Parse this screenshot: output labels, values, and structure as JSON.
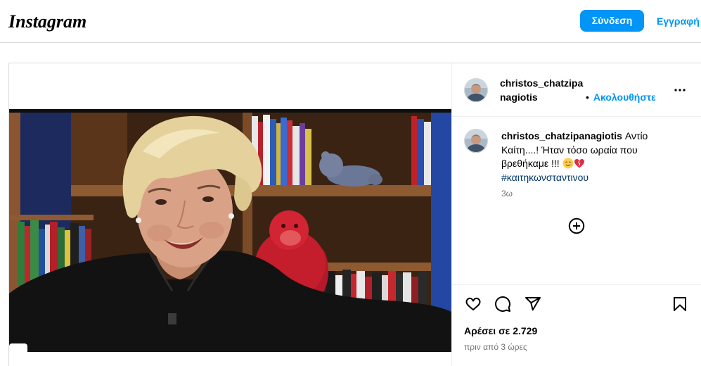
{
  "header": {
    "logo_text": "Instagram",
    "login_label": "Σύνδεση",
    "signup_label": "Εγγραφή"
  },
  "post": {
    "author": {
      "username": "christos_chatzipanagiotis",
      "follow_separator": "•",
      "follow_label": "Ακολουθήστε",
      "more_icon": "more-options-icon"
    },
    "caption": {
      "username": "christos_chatzipanagiotis",
      "text": "Αντίο Καίτη....! Ήταν τόσο ωραία που βρεθήκαμε !!!",
      "emoji_icons": [
        "smiling-face-with-tear",
        "broken-heart"
      ],
      "hashtag": "#καιτηκωνσταντινου",
      "time": "3ω"
    },
    "load_more_icon": "plus-circle-icon",
    "actions": {
      "like_icon": "heart-icon",
      "comment_icon": "comment-icon",
      "share_icon": "share-icon",
      "save_icon": "bookmark-icon"
    },
    "likes_text": "Αρέσει σε 2.729",
    "posted_time": "πριν από 3 ώρες"
  },
  "colors": {
    "accent": "#0095f6",
    "text": "#000000",
    "secondary": "#737373",
    "border": "#dbdbdb",
    "link": "#00376b"
  }
}
